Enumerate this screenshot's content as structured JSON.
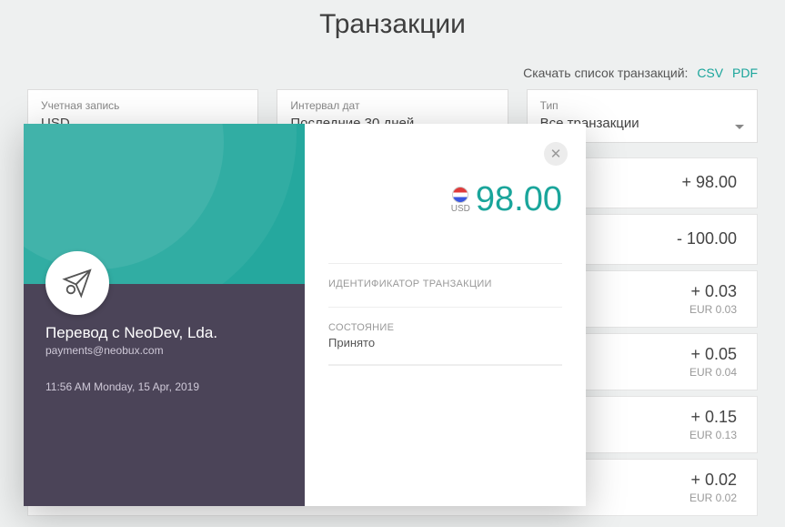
{
  "page": {
    "title": "Транзакции"
  },
  "export": {
    "label": "Скачать список транзакций:",
    "csv": "CSV",
    "pdf": "PDF"
  },
  "filters": {
    "account": {
      "label": "Учетная запись",
      "value": "USD"
    },
    "daterange": {
      "label": "Интервал дат",
      "value": "Последние 30 дней"
    },
    "type": {
      "label": "Тип",
      "value": "Все транзакции"
    }
  },
  "transactions": [
    {
      "primary": "+ 98.00",
      "secondary": ""
    },
    {
      "primary": "- 100.00",
      "secondary": ""
    },
    {
      "primary": "+ 0.03",
      "secondary": "EUR 0.03"
    },
    {
      "primary": "+ 0.05",
      "secondary": "EUR 0.04"
    },
    {
      "primary": "+ 0.15",
      "secondary": "EUR 0.13"
    },
    {
      "primary": "+ 0.02",
      "secondary": "EUR 0.02"
    }
  ],
  "modal": {
    "currency": "USD",
    "amount": "98.00",
    "sender": "Перевод с NeoDev, Lda.",
    "email": "payments@neobux.com",
    "timestamp": "11:56 AM Monday, 15 Apr, 2019",
    "fields": {
      "id_label": "ИДЕНТИФИКАТОР ТРАНЗАКЦИИ",
      "id_value": "",
      "status_label": "СОСТОЯНИЕ",
      "status_value": "Принято"
    }
  }
}
